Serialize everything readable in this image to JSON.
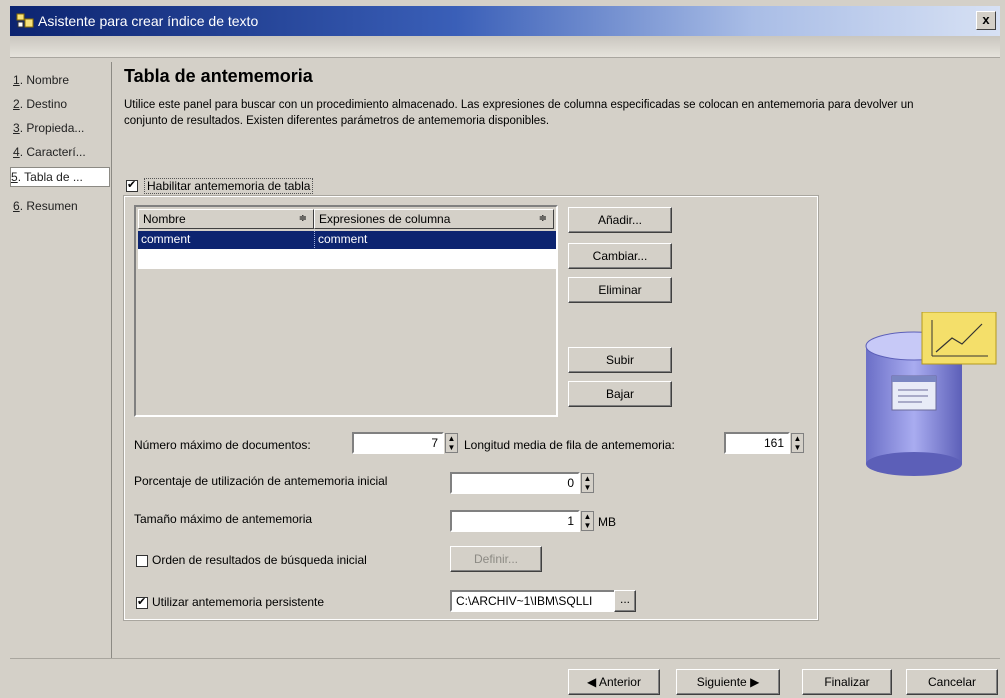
{
  "window": {
    "title": "Asistente para crear índice de texto",
    "close_label": "x"
  },
  "sidebar": {
    "items": [
      {
        "num": "1",
        "label": ". Nombre"
      },
      {
        "num": "2",
        "label": ". Destino"
      },
      {
        "num": "3",
        "label": ". Propieda..."
      },
      {
        "num": "4",
        "label": ". Caracterí..."
      },
      {
        "num": "5",
        "label": ". Tabla de ..."
      },
      {
        "num": "6",
        "label": ". Resumen"
      }
    ],
    "selected_index": 4
  },
  "main": {
    "title": "Tabla de antememoria",
    "description": "Utilice este panel para buscar con un procedimiento almacenado. Las expresiones de columna especificadas se colocan en antememoria para devolver un conjunto de resultados. Existen diferentes parámetros de antememoria disponibles.",
    "enable_cache": {
      "label": "Habilitar antememoria de tabla",
      "checked": true
    },
    "table": {
      "headers": [
        "Nombre",
        "Expresiones de columna"
      ],
      "sort_glyph": "≑",
      "rows": [
        {
          "name": "comment",
          "expr": "comment"
        }
      ]
    },
    "buttons": {
      "add": "Añadir...",
      "change": "Cambiar...",
      "delete": "Eliminar",
      "up": "Subir",
      "down": "Bajar"
    },
    "max_docs": {
      "label": "Número máximo de documentos:",
      "value": "7"
    },
    "avg_row_len": {
      "label": "Longitud media de fila de antememoria:",
      "value": "161"
    },
    "initial_pct": {
      "label": "Porcentaje de utilización de antememoria inicial",
      "value": "0"
    },
    "max_size": {
      "label": "Tamaño máximo de antememoria",
      "value": "1",
      "unit": "MB"
    },
    "initial_order": {
      "label": "Orden de resultados de búsqueda inicial",
      "checked": false,
      "button": "Definir..."
    },
    "persistent": {
      "label": "Utilizar antememoria persistente",
      "checked": true,
      "path": "C:\\ARCHIV~1\\IBM\\SQLLI",
      "browse": "..."
    }
  },
  "footer": {
    "back": "Anterior",
    "next": "Siguiente",
    "finish": "Finalizar",
    "cancel": "Cancelar"
  }
}
